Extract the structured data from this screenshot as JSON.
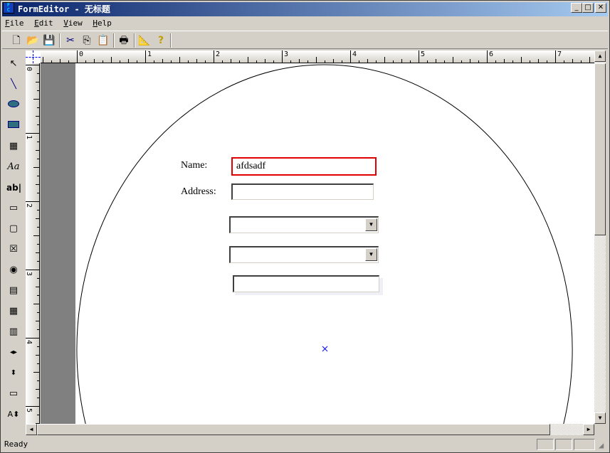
{
  "window": {
    "title": "FormEditor - 无标题",
    "icon": "app-icon",
    "controls": [
      "minimize",
      "maximize",
      "close"
    ]
  },
  "menu": [
    {
      "label": "File",
      "key": "F",
      "rest": "ile"
    },
    {
      "label": "Edit",
      "key": "E",
      "rest": "dit"
    },
    {
      "label": "View",
      "key": "V",
      "rest": "iew"
    },
    {
      "label": "Help",
      "key": "H",
      "rest": "elp"
    }
  ],
  "toolbar": [
    "new-icon",
    "open-icon",
    "save-icon",
    "cut-icon",
    "copy-icon",
    "paste-icon",
    "print-icon",
    "design-icon",
    "help-icon"
  ],
  "toolbox": [
    "pointer",
    "line",
    "ellipse",
    "rectangle",
    "image",
    "label",
    "textbox",
    "groupbox",
    "button",
    "checkbox",
    "radio",
    "listbox",
    "grid",
    "list",
    "hscroll",
    "spin",
    "tab",
    "font"
  ],
  "ruler": {
    "h_labels": [
      "0",
      "1",
      "2",
      "3",
      "4",
      "5",
      "6",
      "7"
    ],
    "v_labels": [
      "0",
      "1",
      "2",
      "3",
      "4",
      "5"
    ]
  },
  "form": {
    "name_label": "Name:",
    "name_value": "afdsadf",
    "address_label": "Address:",
    "address_value": "",
    "combo1_value": "",
    "combo2_value": "",
    "textbox3_value": ""
  },
  "status": {
    "text": "Ready"
  },
  "colors": {
    "selection": "#e00000",
    "title_start": "#0a246a",
    "title_end": "#a6caf0"
  }
}
